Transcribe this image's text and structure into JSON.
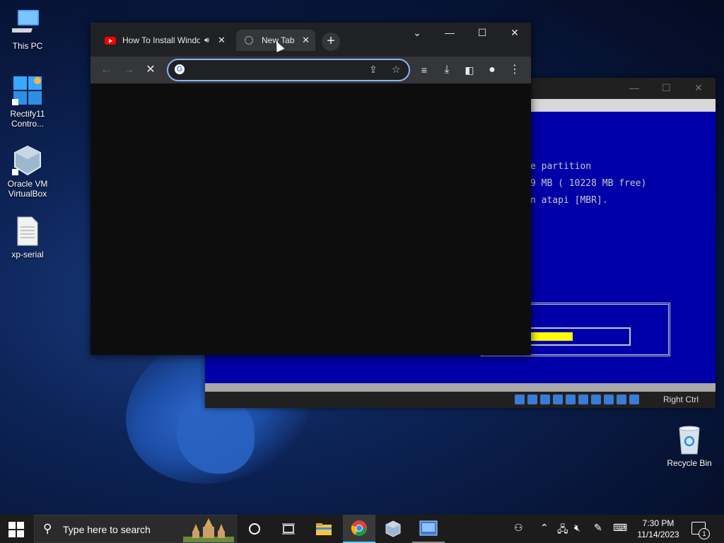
{
  "desktop": {
    "icons": [
      {
        "label": "This PC"
      },
      {
        "label": "Rectify11 Contro..."
      },
      {
        "label": "Oracle VM VirtualBox"
      },
      {
        "label": "xp-serial"
      },
      {
        "label": "Recycle Bin"
      }
    ]
  },
  "vm_window": {
    "screen_lines": [
      "e partition",
      "9 MB ( 10228 MB free)",
      "n atapi [MBR]."
    ],
    "progress": 0.62,
    "host_key": "Right Ctrl"
  },
  "chrome": {
    "tabs": [
      {
        "title": "How To Install Windo",
        "icon": "youtube-icon",
        "audio": "speaker-icon"
      },
      {
        "title": "New Tab",
        "icon": "globe-icon"
      }
    ],
    "omnibox": {
      "value": "",
      "placeholder": ""
    },
    "close_glyph": "✕",
    "new_tab_glyph": "+"
  },
  "taskbar": {
    "search_placeholder": "Type here to search",
    "time": "7:30 PM",
    "date": "11/14/2023",
    "notification_count": "1"
  },
  "colors": {
    "accent": "#8ab4f8",
    "vm_blue": "#0000a8",
    "progress_yellow": "#ffff00"
  }
}
